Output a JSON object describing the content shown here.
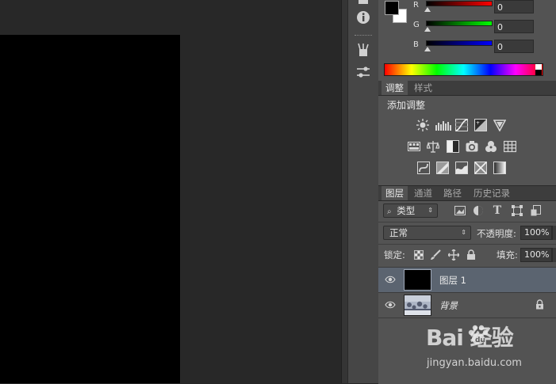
{
  "color_panel": {
    "channels": [
      {
        "label": "R",
        "value": "0",
        "gradient": [
          "#000000",
          "#ff0000"
        ]
      },
      {
        "label": "G",
        "value": "0",
        "gradient": [
          "#000000",
          "#00ff00"
        ]
      },
      {
        "label": "B",
        "value": "0",
        "gradient": [
          "#000000",
          "#0000ff"
        ]
      }
    ],
    "foreground_color": "#000000",
    "background_color": "#ffffff"
  },
  "adjustments": {
    "tabs": [
      "调整",
      "样式"
    ],
    "active_tab": "调整",
    "add_label": "添加调整",
    "icons_row1": [
      "brightness-icon",
      "levels-icon",
      "curves-icon",
      "exposure-icon",
      "vibrance-icon"
    ],
    "icons_row2": [
      "hue-saturation-icon",
      "color-balance-icon",
      "black-white-icon",
      "photo-filter-icon",
      "channel-mixer-icon",
      "color-lookup-icon"
    ],
    "icons_row3": [
      "invert-icon",
      "posterize-icon",
      "threshold-icon",
      "selective-color-icon",
      "gradient-map-icon"
    ]
  },
  "layers": {
    "tabs": [
      "图层",
      "通道",
      "路径",
      "历史记录"
    ],
    "active_tab": "图层",
    "filter_label": "类型",
    "blend_mode": "正常",
    "opacity_label": "不透明度:",
    "opacity_value": "100%",
    "lock_label": "锁定:",
    "fill_label": "填充:",
    "fill_value": "100%",
    "items": [
      {
        "name": "图层 1",
        "selected": true,
        "locked": false
      },
      {
        "name": "背景",
        "selected": false,
        "locked": true
      }
    ]
  },
  "watermark": {
    "logo": "Bai 经验",
    "url": "jingyan.baidu.com"
  }
}
